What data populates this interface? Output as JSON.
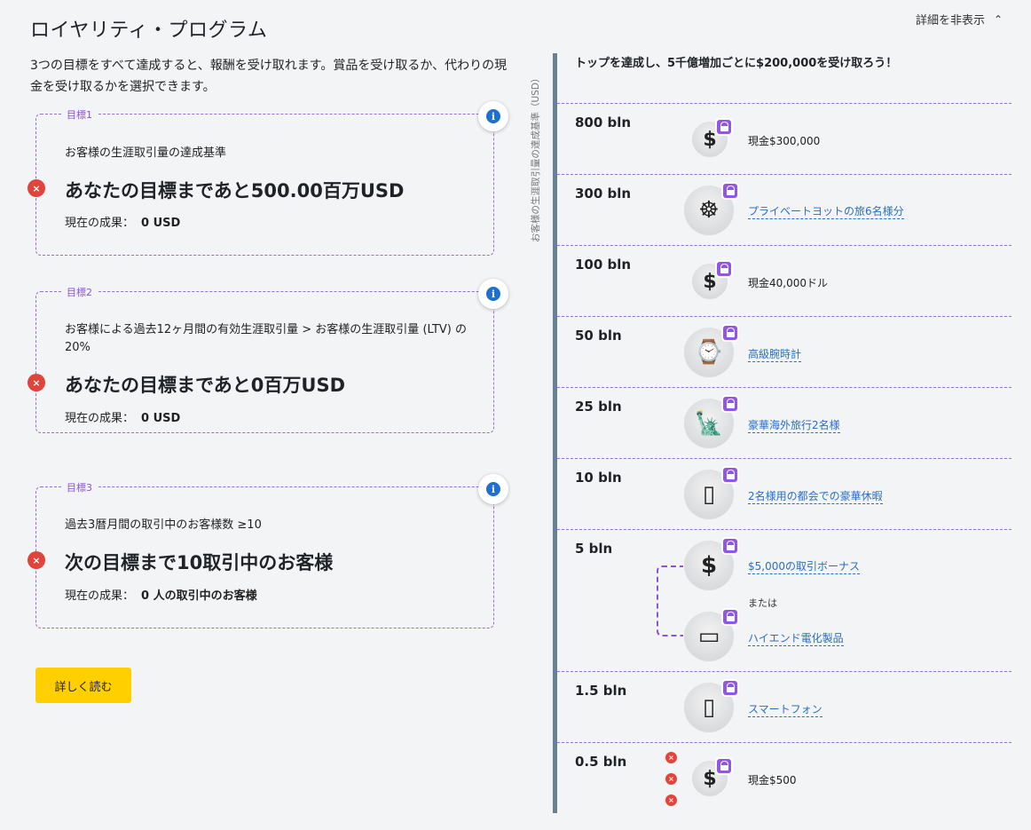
{
  "title": "ロイヤリティ・プログラム",
  "toggle": {
    "label": "詳細を非表示",
    "icon": "chevron-up-icon"
  },
  "intro": "3つの目標をすべて達成すると、報酬を受け取れます。賞品を受け取るか、代わりの現金を受け取るかを選択できます。",
  "goals": [
    {
      "label": "目標1",
      "criteria": "お客様の生涯取引量の達成基準",
      "main": "あなたの目標まであと500.00百万USD",
      "current_label": "現在の成果：",
      "current_value": "0 USD"
    },
    {
      "label": "目標2",
      "criteria": "お客様による過去12ヶ月間の有効生涯取引量 > お客様の生涯取引量 (LTV) の20%",
      "main": "あなたの目標まであと0百万USD",
      "current_label": "現在の成果：",
      "current_value": "0 USD"
    },
    {
      "label": "目標3",
      "criteria": "過去3暦月間の取引中のお客様数 ≥10",
      "main": "次の目標まで10取引中のお客様",
      "current_label": "現在の成果：",
      "current_value": "0 人の取引中のお客様"
    }
  ],
  "read_more": "詳しく読む",
  "axis_label": "お客様の生涯取引量の達成基準（USD）",
  "right_header": "トップを達成し、5千億増加ごとに$200,000を受け取ろう！",
  "tiers": [
    {
      "value": "800 bln",
      "prize": "現金$300,000",
      "icon": "dollar-icon",
      "link": false
    },
    {
      "value": "300 bln",
      "prize": "プライベートヨットの旅6名様分",
      "icon": "ship-wheel-icon",
      "link": true
    },
    {
      "value": "100 bln",
      "prize": "現金40,000ドル",
      "icon": "dollar-icon",
      "link": false
    },
    {
      "value": "50 bln",
      "prize": "高級腕時計",
      "icon": "watch-icon",
      "link": true
    },
    {
      "value": "25 bln",
      "prize": "豪華海外旅行2名様",
      "icon": "landmarks-icon",
      "link": true
    },
    {
      "value": "10 bln",
      "prize": "2名様用の都会での豪華休暇",
      "icon": "suitcase-icon",
      "link": true
    },
    {
      "value": "5 bln",
      "prize": "$5,000の取引ボーナス",
      "prize2": "ハイエンド電化製品",
      "or": "または",
      "icon": "trading-bonus-icon",
      "icon2": "electronics-icon",
      "link": true
    },
    {
      "value": "1.5 bln",
      "prize": "スマートフォン",
      "icon": "smartphone-icon",
      "link": true
    },
    {
      "value": "0.5 bln",
      "prize": "現金$500",
      "icon": "dollar-icon",
      "link": false
    }
  ],
  "colors": {
    "accent": "#9257e0",
    "fail": "#e0443b",
    "link": "#2a6fc1",
    "button": "#ffcf00",
    "info": "#1f6fd0"
  }
}
